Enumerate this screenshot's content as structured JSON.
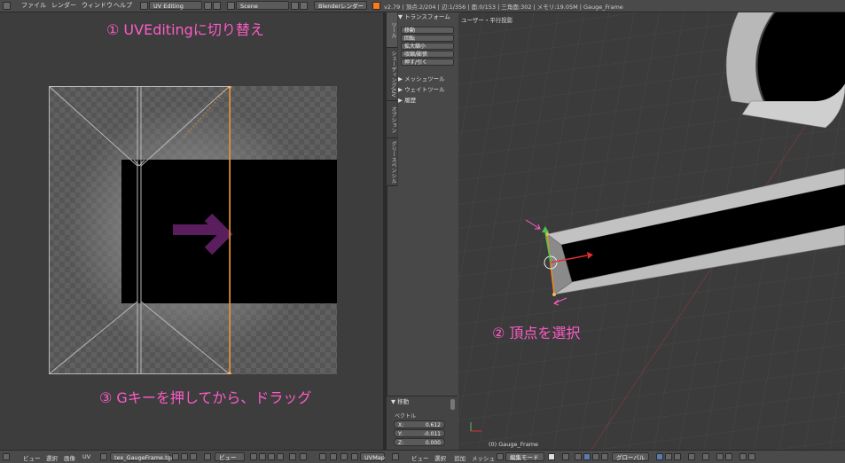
{
  "topbar": {
    "menus": [
      "ファイル",
      "レンダー",
      "ウィンドウ",
      "ヘルプ"
    ],
    "layout": "UV Editing",
    "scene": "Scene",
    "engine": "Blenderレンダー",
    "stats": "v2.79 | 頂点:2/204 | 辺:1/356 | 面:0/153 | 三角面:302 | メモリ:19.05M | Gauge_Frame"
  },
  "annotations": {
    "step1": "① UVEditingに切り替え",
    "step2": "② 頂点を選択",
    "step3": "③ Gキーを押してから、ドラッグ"
  },
  "toolshelf": {
    "tabs": [
      "ツール",
      "シェーディング/UV",
      "オプション",
      "グリースペンシル"
    ],
    "transform_header": "▼ トランスフォーム",
    "transform_buttons": [
      "移動",
      "回転",
      "拡大縮小",
      "収縮/膨張",
      "押す/引く"
    ],
    "mesh_tools": "▶ メッシュツール",
    "weight_tools": "▶ ウェイトツール",
    "history": "▶ 履歴",
    "op_header": "▼ 移動",
    "vector_label": "ベクトル",
    "vector": {
      "x": "X:",
      "x_val": "0.612",
      "y": "Y:",
      "y_val": "-0.011",
      "z": "Z:",
      "z_val": "0.000"
    }
  },
  "view3d": {
    "title": "ユーザー・平行投影",
    "object": "(0) Gauge_Frame"
  },
  "bottombar": {
    "uv_menus": [
      "ビュー",
      "選択",
      "画像",
      "UV"
    ],
    "image": "tex_GaugeFrame.tga",
    "uv_view": "ビュー",
    "uvmap": "UVMap",
    "v3d_menus": [
      "ビュー",
      "選択",
      "追加",
      "メッシュ"
    ],
    "mode": "編集モード",
    "orientation": "グローバル"
  },
  "colors": {
    "annotation": "#ff5bc8",
    "accent": "#f08a24",
    "arrow": "#5a1e5e"
  }
}
